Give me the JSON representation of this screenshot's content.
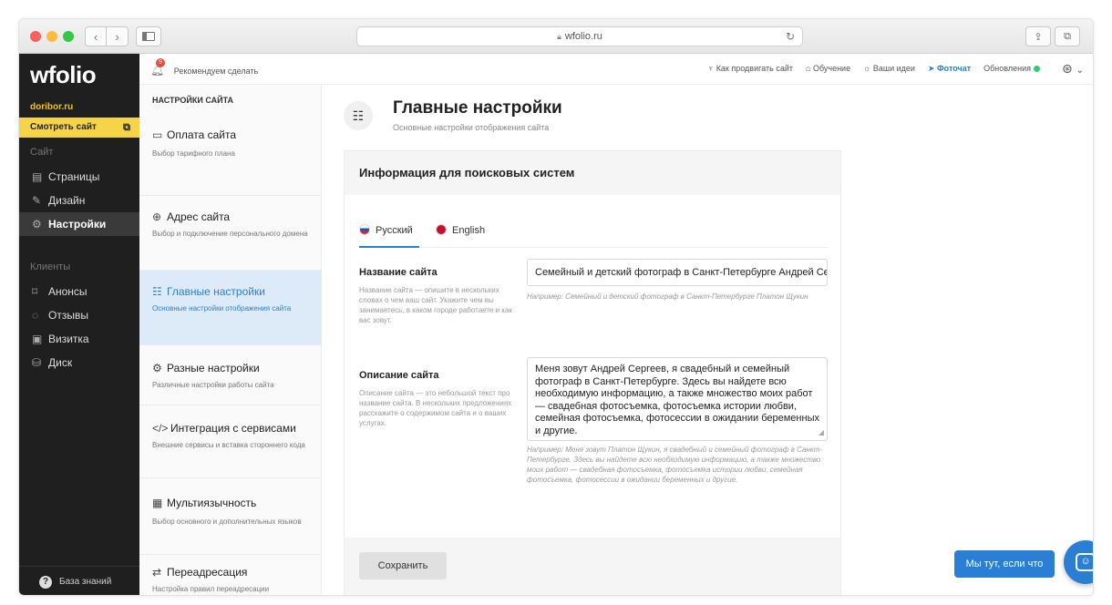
{
  "browser": {
    "url": "wfolio.ru"
  },
  "sidebar": {
    "logo": "wfolio",
    "domain": "doribor.ru",
    "view_site": "Смотреть сайт",
    "section_site": "Сайт",
    "section_clients": "Клиенты",
    "items": [
      {
        "label": "Страницы",
        "icon": "page-icon"
      },
      {
        "label": "Дизайн",
        "icon": "brush-icon"
      },
      {
        "label": "Настройки",
        "icon": "gear-icon"
      },
      {
        "label": "Анонсы",
        "icon": "megaphone-icon"
      },
      {
        "label": "Отзывы",
        "icon": "chat-icon"
      },
      {
        "label": "Визитка",
        "icon": "card-icon"
      },
      {
        "label": "Диск",
        "icon": "disk-icon"
      }
    ],
    "knowledge_base": "База знаний"
  },
  "topbar": {
    "recommend": "Рекомендуем сделать",
    "badge": "9",
    "links": [
      "Как продвигать сайт",
      "Обучение",
      "Ваши идеи",
      "Фоточат",
      "Обновления"
    ]
  },
  "settings": {
    "header": "НАСТРОЙКИ САЙТА",
    "items": [
      {
        "title": "Оплата сайта",
        "desc": "Выбор тарифного плана"
      },
      {
        "title": "Адрес сайта",
        "desc": "Выбор и подключение персонального домена"
      },
      {
        "title": "Главные настройки",
        "desc": "Основные настройки отображения сайта"
      },
      {
        "title": "Разные настройки",
        "desc": "Различные настройки работы сайта"
      },
      {
        "title": "Интеграция с сервисами",
        "desc": "Внешние сервисы и вставка стороннего кода"
      },
      {
        "title": "Мультиязычность",
        "desc": "Выбор основного и дополнительных языков"
      },
      {
        "title": "Переадресация",
        "desc": "Настройка правил переадресации"
      }
    ]
  },
  "page": {
    "title": "Главные настройки",
    "subtitle": "Основные настройки отображения сайта",
    "card_title": "Информация для поисковых систем",
    "tabs": [
      "Русский",
      "English"
    ],
    "site_name_label": "Название сайта",
    "site_name_help": "Название сайта — опишите в нескольких словах о чем ваш сайт. Укажите чем вы занимаетесь, в каком городе работаете и как вас зовут.",
    "site_name_value": "Семейный и детский фотограф в Санкт-Петербурге Андрей Сергеев",
    "site_name_example": "Например: Семейный и детский фотограф в Санкт-Петербурге Платон Щукин",
    "desc_label": "Описание сайта",
    "desc_help": "Описание сайта — это небольшой текст про название сайта. В нескольких предложениях расскажите о содержимом сайта и о ваших услугах.",
    "desc_value": "Меня зовут Андрей Сергеев, я свадебный и семейный фотограф в Санкт-Петербурге. Здесь вы найдете всю необходимую информацию, а также множество моих работ — свадебная фотосъемка, фотосъемка истории любви, семейная фотосъемка, фотосессии в ожидании беременных и другие.",
    "desc_example": "Например: Меня зовут Платон Щукин, я свадебный и семейный фотограф в Санкт-Петербурге. Здесь вы найдете всю необходимую информацию, а также множество моих работ — свадебная фотосъемка, фотосъемка истории любви, семейная фотосъемка, фотосессии в ожидании беременных и другие.",
    "save": "Сохранить"
  },
  "chat": {
    "label": "Мы тут, если что"
  },
  "colors": {
    "accent": "#2a7fd4",
    "sidebar_bg": "#1f1f1f",
    "highlight": "#f5d547"
  }
}
